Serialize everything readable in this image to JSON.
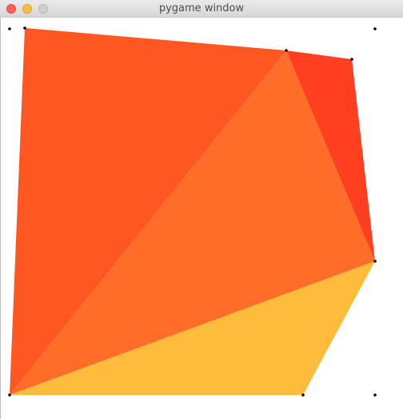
{
  "window": {
    "title": "pygame window"
  },
  "colors": {
    "triangle_left": "#ff5722",
    "triangle_center": "#ff6d28",
    "triangle_top_right": "#ff3f1f",
    "triangle_bottom": "#ffbb3c",
    "point": "#000000",
    "background": "#ffffff"
  },
  "icons": {
    "close": "close-button",
    "minimize": "minimize-button",
    "zoom": "zoom-button"
  }
}
